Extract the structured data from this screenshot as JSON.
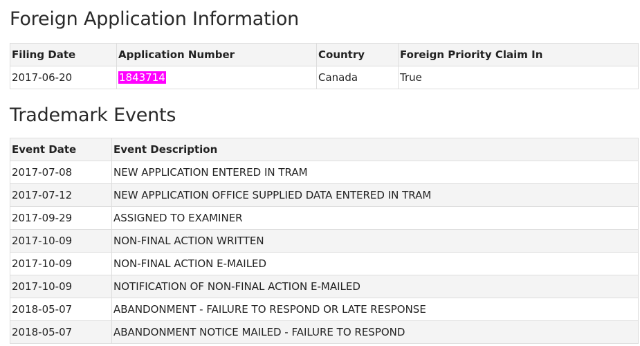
{
  "foreign_section": {
    "title": "Foreign Application Information",
    "headers": [
      "Filing Date",
      "Application Number",
      "Country",
      "Foreign Priority Claim In"
    ],
    "row": {
      "filing_date": "2017-06-20",
      "application_number": "1843714",
      "country": "Canada",
      "priority_claim": "True"
    },
    "highlight_color": "#ff00ff"
  },
  "events_section": {
    "title": "Trademark Events",
    "headers": [
      "Event Date",
      "Event Description"
    ],
    "rows": [
      {
        "date": "2017-07-08",
        "description": "NEW APPLICATION ENTERED IN TRAM"
      },
      {
        "date": "2017-07-12",
        "description": "NEW APPLICATION OFFICE SUPPLIED DATA ENTERED IN TRAM"
      },
      {
        "date": "2017-09-29",
        "description": "ASSIGNED TO EXAMINER"
      },
      {
        "date": "2017-10-09",
        "description": "NON-FINAL ACTION WRITTEN"
      },
      {
        "date": "2017-10-09",
        "description": "NON-FINAL ACTION E-MAILED"
      },
      {
        "date": "2017-10-09",
        "description": "NOTIFICATION OF NON-FINAL ACTION E-MAILED"
      },
      {
        "date": "2018-05-07",
        "description": "ABANDONMENT - FAILURE TO RESPOND OR LATE RESPONSE"
      },
      {
        "date": "2018-05-07",
        "description": "ABANDONMENT NOTICE MAILED - FAILURE TO RESPOND"
      }
    ]
  }
}
